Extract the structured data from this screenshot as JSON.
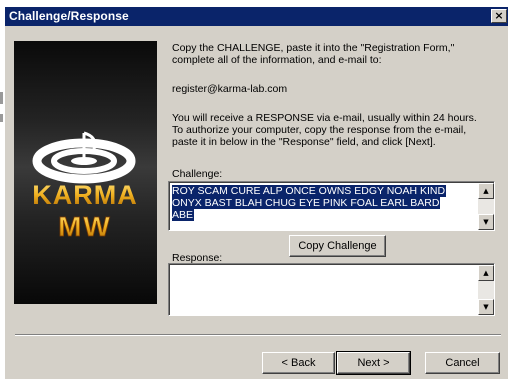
{
  "window": {
    "title": "Challenge/Response",
    "close_glyph": "×"
  },
  "logo": {
    "brand_top": "KARMA",
    "brand_bottom": "MW"
  },
  "instructions": {
    "p1_line1": "Copy the CHALLENGE, paste it into the \"Registration Form,\"",
    "p1_line2": "complete all of the information, and e-mail to:",
    "email": "register@karma-lab.com",
    "p2_line1": "You will receive a RESPONSE via e-mail, usually within 24 hours.",
    "p2_line2": "To authorize your computer, copy the response from the e-mail,",
    "p2_line3": "paste it in below in the \"Response\" field, and click [Next]."
  },
  "challenge": {
    "label": "Challenge:",
    "lines": [
      "ROY SCAM CURE ALP ONCE OWNS EDGY NOAH KIND",
      "ONYX BAST BLAH CHUG EYE PINK FOAL EARL BARD",
      "ABE"
    ]
  },
  "copy_button": "Copy Challenge",
  "response": {
    "label": "Response:",
    "value": ""
  },
  "buttons": {
    "back": "< Back",
    "next": "Next >",
    "cancel": "Cancel"
  },
  "colors": {
    "titlebar": "#0a246a",
    "dialog": "#d4d0c8",
    "selection": "#0a246a"
  }
}
